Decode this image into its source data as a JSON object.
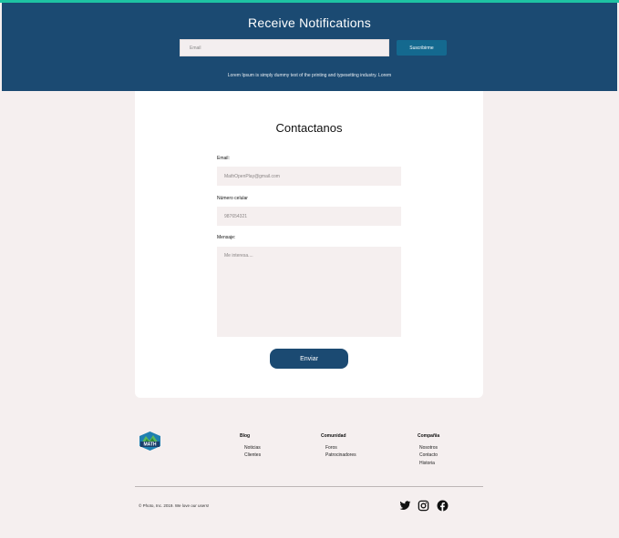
{
  "newsletter": {
    "title": "Receive Notifications",
    "email_placeholder": "Email",
    "subscribe_label": "Suscribirme",
    "description": "Lorem Ipsum is simply dummy text of the printing and typesetting industry. Lorem"
  },
  "contact": {
    "title": "Contactanos",
    "email_label": "Email:",
    "email_value": "MathOpenPlay@gmail.com",
    "phone_label": "Número celular",
    "phone_value": "987654321",
    "message_label": "Mensaje:",
    "message_placeholder": "Me interesa....",
    "submit_label": "Enviar"
  },
  "footer": {
    "logo_text": "MATH",
    "columns": [
      {
        "title": "Blog",
        "items": [
          "Noticias",
          "Clientes"
        ]
      },
      {
        "title": "Comunidad",
        "items": [
          "Foros",
          "Patrocinadores"
        ]
      },
      {
        "title": "Compañia",
        "items": [
          "Nosotros",
          "Contacto",
          "Historia"
        ]
      }
    ],
    "copyright": "© Photo, Inc. 2019. We love our users!",
    "social_icons": [
      "twitter-icon",
      "instagram-icon",
      "facebook-icon"
    ]
  },
  "colors": {
    "accent_bar": "#1ec3a3",
    "hero_bg": "#1b4a72",
    "subscribe_bg": "#14698f",
    "page_bg": "#f5efef"
  }
}
